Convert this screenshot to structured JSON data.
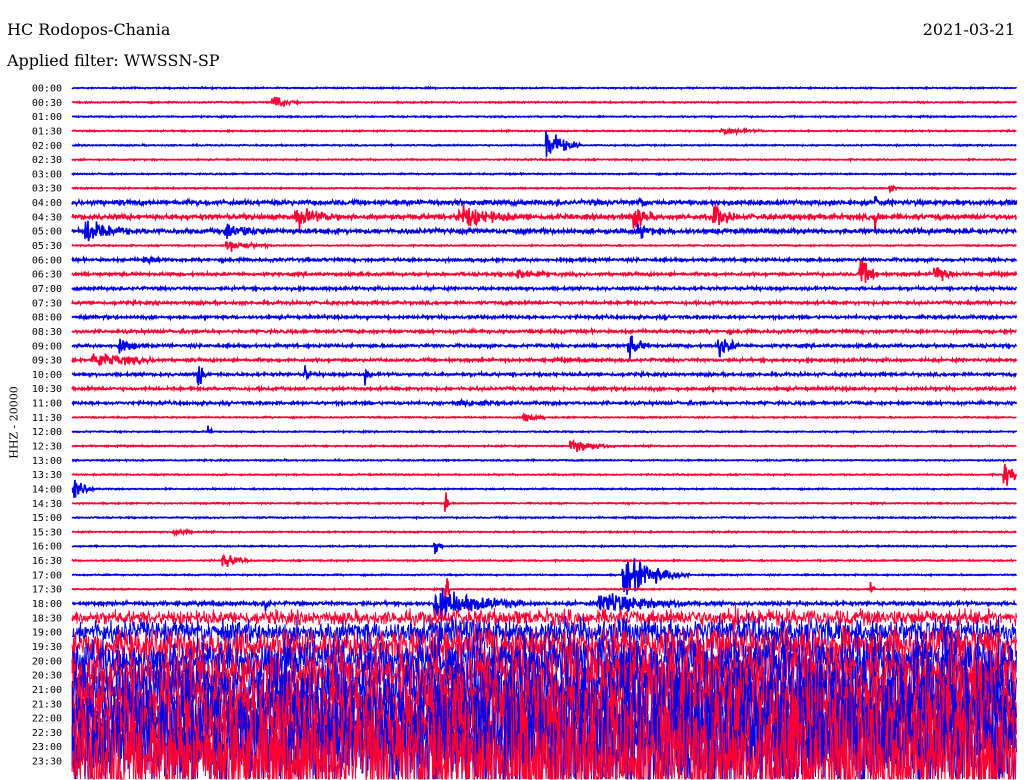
{
  "header": {
    "station": "HC Rodopos-Chania",
    "date": "2021-03-21",
    "filter_label": "Applied filter: WWSSN-SP"
  },
  "axis": {
    "ylabel": "HHZ - 20000"
  },
  "colors": {
    "trace_a": "#0000e6",
    "trace_b": "#ff0033",
    "background": "#ffffff"
  },
  "chart_data": {
    "type": "line",
    "title": "HC Rodopos-Chania",
    "ylabel": "HHZ - 20000",
    "rows": [
      "00:00",
      "00:30",
      "01:00",
      "01:30",
      "02:00",
      "02:30",
      "03:00",
      "03:30",
      "04:00",
      "04:30",
      "05:00",
      "05:30",
      "06:00",
      "06:30",
      "07:00",
      "07:30",
      "08:00",
      "08:30",
      "09:00",
      "09:30",
      "10:00",
      "10:30",
      "11:00",
      "11:30",
      "12:00",
      "12:30",
      "13:00",
      "13:30",
      "14:00",
      "14:30",
      "15:00",
      "15:30",
      "16:00",
      "16:30",
      "17:00",
      "17:30",
      "18:00",
      "18:30",
      "19:00",
      "19:30",
      "20:00",
      "20:30",
      "21:00",
      "21:30",
      "22:00",
      "22:30",
      "23:00",
      "23:30"
    ],
    "row_minutes": 30,
    "grid": false,
    "legend": "none"
  }
}
